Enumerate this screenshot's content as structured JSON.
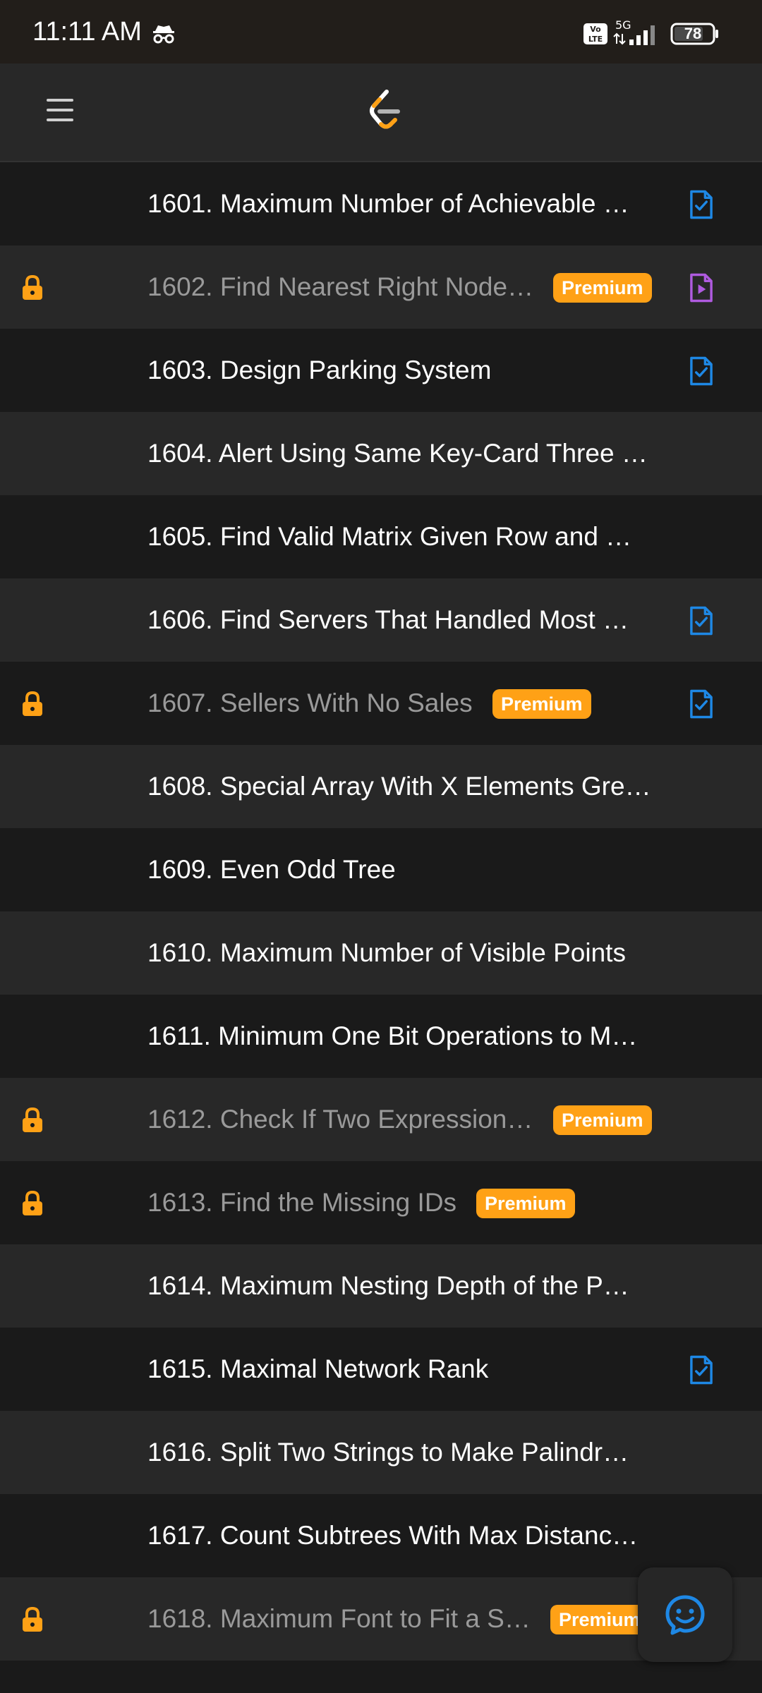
{
  "status_bar": {
    "time": "11:11 AM",
    "network": "5G",
    "battery": "78",
    "icons": [
      "incognito-icon",
      "volte-icon",
      "signal-icon",
      "battery-icon"
    ]
  },
  "header": {
    "icons": [
      "menu-icon",
      "leetcode-logo-icon"
    ]
  },
  "colors": {
    "premium": "#ffa116",
    "solution_blue": "#1e88e5",
    "video_purple": "#b05be0",
    "row_dark": "#1a1a1a",
    "row_light": "#282828"
  },
  "problems": [
    {
      "title": "1601. Maximum Number of Achievable …",
      "locked": false,
      "premium": false,
      "solution": "article"
    },
    {
      "title": "1602. Find Nearest Right Node…",
      "locked": true,
      "premium": true,
      "solution": "video"
    },
    {
      "title": "1603. Design Parking System",
      "locked": false,
      "premium": false,
      "solution": "article"
    },
    {
      "title": "1604. Alert Using Same Key-Card Three …",
      "locked": false,
      "premium": false,
      "solution": "none"
    },
    {
      "title": "1605. Find Valid Matrix Given Row and …",
      "locked": false,
      "premium": false,
      "solution": "none"
    },
    {
      "title": "1606. Find Servers That Handled Most …",
      "locked": false,
      "premium": false,
      "solution": "article"
    },
    {
      "title": "1607. Sellers With No Sales",
      "locked": true,
      "premium": true,
      "solution": "article"
    },
    {
      "title": "1608. Special Array With X Elements Gre…",
      "locked": false,
      "premium": false,
      "solution": "none"
    },
    {
      "title": "1609. Even Odd Tree",
      "locked": false,
      "premium": false,
      "solution": "none"
    },
    {
      "title": "1610. Maximum Number of Visible Points",
      "locked": false,
      "premium": false,
      "solution": "none"
    },
    {
      "title": "1611. Minimum One Bit Operations to M…",
      "locked": false,
      "premium": false,
      "solution": "none"
    },
    {
      "title": "1612. Check If Two Expression…",
      "locked": true,
      "premium": true,
      "solution": "none"
    },
    {
      "title": "1613. Find the Missing IDs",
      "locked": true,
      "premium": true,
      "solution": "none"
    },
    {
      "title": "1614. Maximum Nesting Depth of the P…",
      "locked": false,
      "premium": false,
      "solution": "none"
    },
    {
      "title": "1615. Maximal Network Rank",
      "locked": false,
      "premium": false,
      "solution": "article"
    },
    {
      "title": "1616. Split Two Strings to Make Palindr…",
      "locked": false,
      "premium": false,
      "solution": "none"
    },
    {
      "title": "1617. Count Subtrees With Max Distanc…",
      "locked": false,
      "premium": false,
      "solution": "none"
    },
    {
      "title": "1618. Maximum Font to Fit a S…",
      "locked": true,
      "premium": true,
      "solution": "none"
    }
  ],
  "premium_label": "Premium",
  "fab": {
    "icon": "chat-smile-icon"
  }
}
